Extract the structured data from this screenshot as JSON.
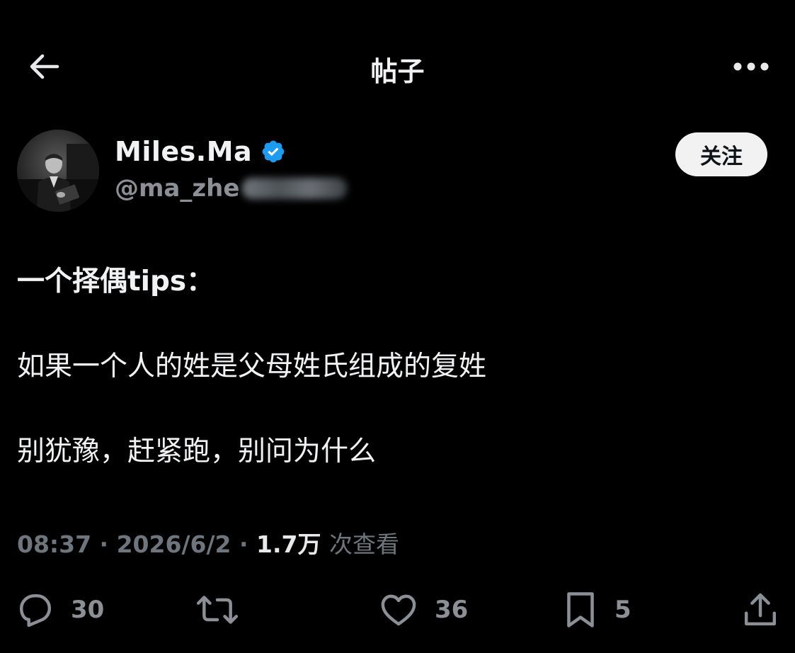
{
  "header": {
    "title": "帖子",
    "back_icon": "arrow-left-icon",
    "more_icon": "more-horizontal-icon"
  },
  "author": {
    "display_name": "Miles.Ma",
    "handle": "@ma_zhe",
    "verified": true,
    "verified_color": "#1d9bf0"
  },
  "follow_button": {
    "label": "关注"
  },
  "post": {
    "lines": [
      "一个择偶tips：",
      "如果一个人的姓是父母姓氏组成的复姓",
      "别犹豫，赶紧跑，别问为什么"
    ]
  },
  "meta": {
    "time": "08:37",
    "date": "2026/6/2",
    "separator": "·",
    "views_count": "1.7万",
    "views_label": "次查看"
  },
  "actions": {
    "reply": {
      "icon": "reply-icon",
      "count": "30"
    },
    "repost": {
      "icon": "repost-icon",
      "count": ""
    },
    "like": {
      "icon": "heart-icon",
      "count": "36"
    },
    "bookmark": {
      "icon": "bookmark-icon",
      "count": "5"
    },
    "share": {
      "icon": "share-icon",
      "count": ""
    }
  },
  "colors": {
    "background": "#000000",
    "text_primary": "#f0f2f3",
    "text_secondary": "#6e767d",
    "follow_bg": "#f2f2f2"
  }
}
